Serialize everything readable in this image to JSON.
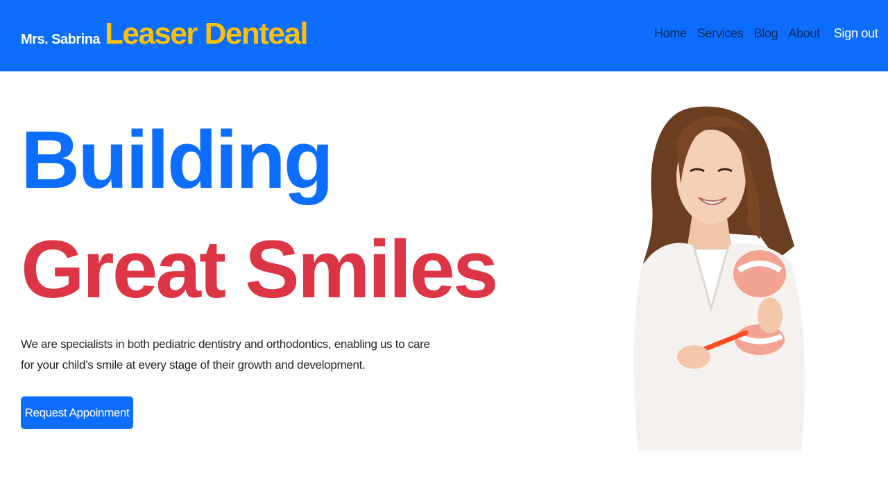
{
  "navbar": {
    "brand_small": "Mrs. Sabrina",
    "brand_big": "Leaser Denteal",
    "links": [
      {
        "label": "Home"
      },
      {
        "label": "Services"
      },
      {
        "label": "Blog"
      },
      {
        "label": "About"
      }
    ],
    "sign_out": "Sign out"
  },
  "hero": {
    "title_line1": "Building",
    "title_line2": "Great Smiles",
    "description": "We are specialists in both pediatric dentistry and orthodontics, enabling us to care for your child’s smile at every stage of their growth and development.",
    "cta_label": "Request Appoinment"
  },
  "colors": {
    "primary": "#0d6efd",
    "brand_accent": "#ffc107",
    "headline_red": "#dc3545",
    "body_text": "#212529"
  }
}
